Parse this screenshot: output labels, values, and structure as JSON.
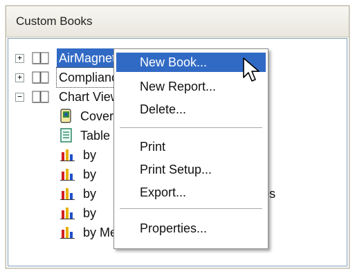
{
  "panel": {
    "title": "Custom Books"
  },
  "tree": {
    "nodes": [
      {
        "label": "AirMagnet Survey",
        "expander": "+"
      },
      {
        "label": "Compliance",
        "expander": "+"
      },
      {
        "label": "Chart Views",
        "expander": "−"
      },
      {
        "label": "Cover Page"
      },
      {
        "label": "Table of Contents"
      },
      {
        "label": "by"
      },
      {
        "label": "by"
      },
      {
        "label": "by                                              nes"
      },
      {
        "label": "by"
      },
      {
        "label": "by Media"
      }
    ]
  },
  "context_menu": {
    "items": [
      {
        "label": "New Book..."
      },
      {
        "label": "New Report..."
      },
      {
        "label": "Delete..."
      },
      {
        "label": "Print"
      },
      {
        "label": "Print Setup..."
      },
      {
        "label": "Export..."
      },
      {
        "label": "Properties..."
      }
    ]
  },
  "colors": {
    "selection": "#316ac5",
    "header": "#ece9d8",
    "border": "#7f9db9"
  }
}
